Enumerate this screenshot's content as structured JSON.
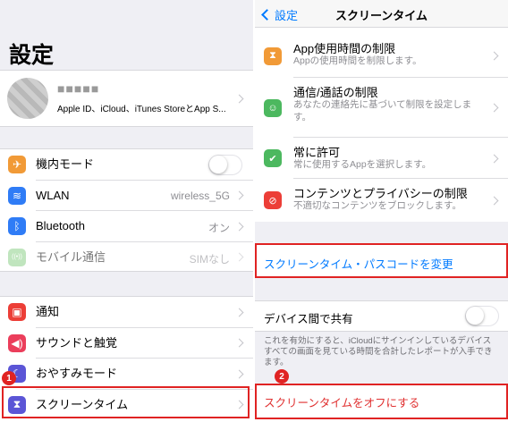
{
  "left": {
    "title": "設定",
    "account": {
      "name_blurred": "■■■■■",
      "subtitle": "Apple ID、iCloud、iTunes StoreとApp S..."
    },
    "connectivity": [
      {
        "label": "機内モード",
        "icon": "airplane-icon",
        "color": "#f19a37",
        "glyph": "✈",
        "control": "toggle"
      },
      {
        "label": "WLAN",
        "value": "wireless_5G",
        "icon": "wifi-icon",
        "color": "#2f7cf6",
        "glyph": "≋"
      },
      {
        "label": "Bluetooth",
        "value": "オン",
        "icon": "bluetooth-icon",
        "color": "#2f7cf6",
        "glyph": "ᛒ"
      },
      {
        "label": "モバイル通信",
        "value": "SIMなし",
        "icon": "cellular-icon",
        "color": "#8ed08a",
        "glyph": "((•))",
        "dimmed": true
      }
    ],
    "general": [
      {
        "label": "通知",
        "icon": "notifications-icon",
        "color": "#ec3e37",
        "glyph": "▣"
      },
      {
        "label": "サウンドと触覚",
        "icon": "sound-icon",
        "color": "#eb3e5b",
        "glyph": "◀)"
      },
      {
        "label": "おやすみモード",
        "icon": "moon-icon",
        "color": "#5b55d6",
        "glyph": "☾"
      },
      {
        "label": "スクリーンタイム",
        "icon": "hourglass-icon",
        "color": "#5b55d6",
        "glyph": "⧗"
      }
    ],
    "step_badge": "1"
  },
  "right": {
    "nav": {
      "back_label": "設定",
      "title": "スクリーンタイム"
    },
    "items": [
      {
        "title": "App使用時間の制限",
        "subtitle": "Appの使用時間を制限します。",
        "icon": "hourglass-icon",
        "color": "#f19a37",
        "glyph": "⧗"
      },
      {
        "title": "通信/通話の制限",
        "subtitle": "あなたの連絡先に基づいて制限を設定します。",
        "icon": "contact-icon",
        "color": "#4cb85f",
        "glyph": "☺"
      },
      {
        "title": "常に許可",
        "subtitle": "常に使用するAppを選択します。",
        "icon": "checkmark-icon",
        "color": "#4cb85f",
        "glyph": "✔"
      },
      {
        "title": "コンテンツとプライバシーの制限",
        "subtitle": "不適切なコンテンツをブロックします。",
        "icon": "restriction-icon",
        "color": "#ec3e37",
        "glyph": "⊘"
      }
    ],
    "passcode_link": "スクリーンタイム・パスコードを変更",
    "share_label": "デバイス間で共有",
    "share_note": "これを有効にすると、iCloudにサインインしているデバイスすべての画面を見ている時間を合計したレポートが入手できます。",
    "turn_off_label": "スクリーンタイムをオフにする",
    "step_badge": "2"
  },
  "colors": {
    "accent": "#007aff",
    "highlight": "#e02323"
  }
}
